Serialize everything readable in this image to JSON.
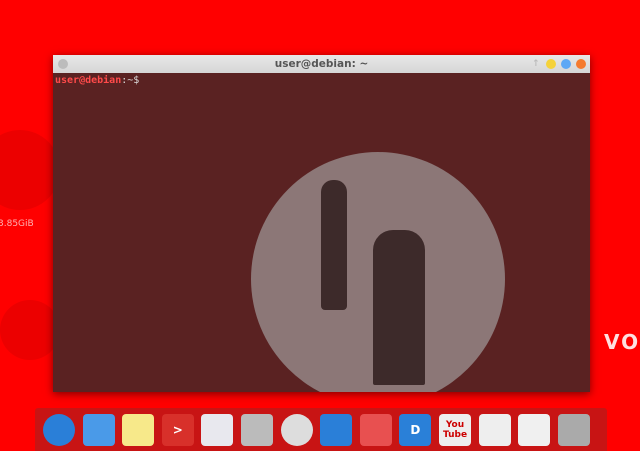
{
  "desktop": {
    "disk_label": "3.85GiB",
    "partial_text": "VO"
  },
  "terminal": {
    "title": "user@debian: ~",
    "prompt_user": "user@debian",
    "prompt_sep": ":",
    "prompt_path": "~$"
  },
  "window_buttons": {
    "colors": [
      "#f5d23a",
      "#5ea8f5",
      "#f57a2e"
    ]
  },
  "dock": {
    "items": [
      {
        "name": "web-browser-icon",
        "color": "#2a7fd8",
        "glyph": ""
      },
      {
        "name": "contacts-icon",
        "color": "#4a9ae8",
        "glyph": ""
      },
      {
        "name": "notes-icon",
        "color": "#f7e98a",
        "glyph": ""
      },
      {
        "name": "terminal-icon",
        "color": "#d8302a",
        "glyph": ">"
      },
      {
        "name": "mail-icon",
        "color": "#e8e8ee",
        "glyph": ""
      },
      {
        "name": "camera-icon",
        "color": "#bbbbbb",
        "glyph": ""
      },
      {
        "name": "launcher-rocket-icon",
        "color": "#dddddd",
        "glyph": ""
      },
      {
        "name": "desktop-icon",
        "color": "#2a7fd8",
        "glyph": ""
      },
      {
        "name": "apps-grid-icon",
        "color": "#e85050",
        "glyph": ""
      },
      {
        "name": "dictionary-icon",
        "color": "#2a80d8",
        "glyph": "D"
      },
      {
        "name": "youtube-icon",
        "color": "#eeeeee",
        "glyph": "You Tube"
      },
      {
        "name": "store-icon",
        "color": "#eeeeee",
        "glyph": ""
      },
      {
        "name": "settings-toggle-icon",
        "color": "#f0f0f0",
        "glyph": ""
      },
      {
        "name": "trash-icon",
        "color": "#aaaaaa",
        "glyph": ""
      }
    ]
  }
}
